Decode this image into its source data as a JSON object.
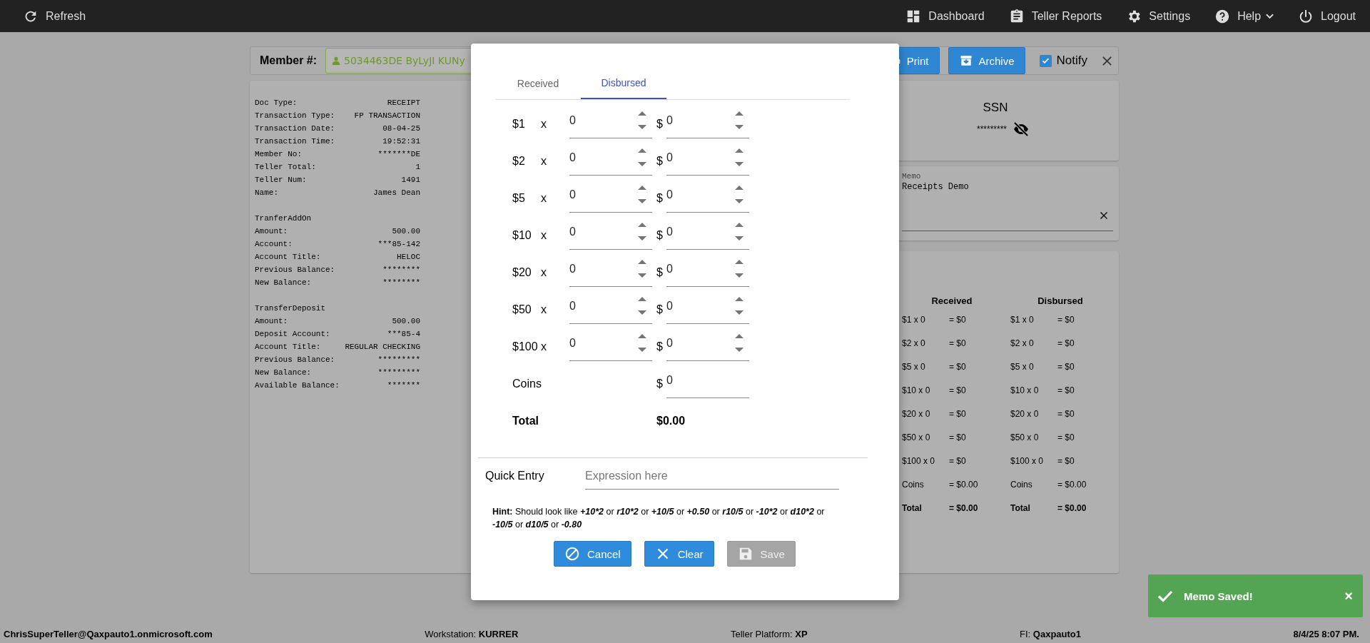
{
  "nav": {
    "left": [
      {
        "kind": "refresh",
        "label": "Refresh"
      }
    ],
    "right": [
      {
        "kind": "dashboard",
        "label": "Dashboard",
        "dropdown": false
      },
      {
        "kind": "reports",
        "label": "Teller Reports",
        "dropdown": false
      },
      {
        "kind": "settings",
        "label": "Settings",
        "dropdown": false
      },
      {
        "kind": "help",
        "label": "Help",
        "dropdown": true
      },
      {
        "kind": "logout",
        "label": "Logout",
        "dropdown": false
      }
    ]
  },
  "member_bar": {
    "label": "Member #:",
    "member": "5034463DE ByLyJI KUNy",
    "buttons": [
      {
        "kind": "print",
        "label": "Print"
      },
      {
        "kind": "archive",
        "label": "Archive"
      }
    ],
    "notify": {
      "label": "Notify",
      "checked": true
    }
  },
  "receipt": {
    "sections": [
      {
        "lines": [
          {
            "label": "Doc Type:",
            "value": "RECEIPT"
          },
          {
            "label": "Transaction Type:",
            "value": "FP TRANSACTION"
          },
          {
            "label": "Transaction Date:",
            "value": "08-04-25"
          },
          {
            "label": "Transaction Time:",
            "value": "19:52:31"
          },
          {
            "label": "Member No:",
            "value": "*******DE"
          },
          {
            "label": "Teller Total:",
            "value": "1"
          },
          {
            "label": "Teller Num:",
            "value": "1491"
          },
          {
            "label": "Name:",
            "value": "James Dean"
          }
        ]
      },
      {
        "heading": "TranferAddOn",
        "lines": [
          {
            "label": "Amount:",
            "value": "500.00"
          },
          {
            "label": "Account:",
            "value": "***85-142"
          },
          {
            "label": "Account Title:",
            "value": "HELOC"
          },
          {
            "label": "Previous Balance:",
            "value": "********"
          },
          {
            "label": "New Balance:",
            "value": "********"
          }
        ]
      },
      {
        "heading": "TransferDeposit",
        "lines": [
          {
            "label": "Amount:",
            "value": "500.00"
          },
          {
            "label": "Deposit Account:",
            "value": "***85-4"
          },
          {
            "label": "Account Title:",
            "value": "REGULAR CHECKING"
          },
          {
            "label": "Previous Balance:",
            "value": "*********"
          },
          {
            "label": "New Balance:",
            "value": "*********"
          },
          {
            "label": "Available Balance:",
            "value": "*******"
          }
        ]
      }
    ]
  },
  "ssn": {
    "label": "SSN",
    "value": "*********",
    "masked": true
  },
  "memo": {
    "label": "Memo",
    "value": "Receipts Demo"
  },
  "summary": {
    "columns": [
      {
        "title": "Received",
        "rows": [
          {
            "kind": "item",
            "label": "$1 x 0",
            "value": "= $0"
          },
          {
            "kind": "item",
            "label": "$2 x 0",
            "value": "= $0"
          },
          {
            "kind": "item",
            "label": "$5 x 0",
            "value": "= $0"
          },
          {
            "kind": "item",
            "label": "$10 x 0",
            "value": "= $0"
          },
          {
            "kind": "item",
            "label": "$20 x 0",
            "value": "= $0"
          },
          {
            "kind": "item",
            "label": "$50 x 0",
            "value": "= $0"
          },
          {
            "kind": "item",
            "label": "$100 x 0",
            "value": "= $0"
          },
          {
            "kind": "item",
            "label": "Coins",
            "value": "= $0.00"
          },
          {
            "kind": "total",
            "label": "Total",
            "value": "= $0.00"
          }
        ]
      },
      {
        "title": "Disbursed",
        "rows": [
          {
            "kind": "item",
            "label": "$1 x 0",
            "value": "= $0"
          },
          {
            "kind": "item",
            "label": "$2 x 0",
            "value": "= $0"
          },
          {
            "kind": "item",
            "label": "$5 x 0",
            "value": "= $0"
          },
          {
            "kind": "item",
            "label": "$10 x 0",
            "value": "= $0"
          },
          {
            "kind": "item",
            "label": "$20 x 0",
            "value": "= $0"
          },
          {
            "kind": "item",
            "label": "$50 x 0",
            "value": "= $0"
          },
          {
            "kind": "item",
            "label": "$100 x 0",
            "value": "= $0"
          },
          {
            "kind": "item",
            "label": "Coins",
            "value": "= $0.00"
          },
          {
            "kind": "total",
            "label": "Total",
            "value": "= $0.00"
          }
        ]
      }
    ]
  },
  "modal": {
    "tabs": [
      {
        "label": "Received",
        "selected": false
      },
      {
        "label": "Disbursed",
        "selected": true
      }
    ],
    "rows": [
      {
        "denomination": "$1",
        "times": "x",
        "count": "0",
        "currency": "$",
        "amount": "0"
      },
      {
        "denomination": "$2",
        "times": "x",
        "count": "0",
        "currency": "$",
        "amount": "0"
      },
      {
        "denomination": "$5",
        "times": "x",
        "count": "0",
        "currency": "$",
        "amount": "0"
      },
      {
        "denomination": "$10",
        "times": "x",
        "count": "0",
        "currency": "$",
        "amount": "0"
      },
      {
        "denomination": "$20",
        "times": "x",
        "count": "0",
        "currency": "$",
        "amount": "0"
      },
      {
        "denomination": "$50",
        "times": "x",
        "count": "0",
        "currency": "$",
        "amount": "0"
      },
      {
        "denomination": "$100",
        "times": "x",
        "count": "0",
        "currency": "$",
        "amount": "0"
      }
    ],
    "coins": {
      "label": "Coins",
      "currency": "$",
      "amount": "0"
    },
    "total": {
      "label": "Total",
      "value": "$0.00"
    },
    "quick_entry": {
      "label": "Quick Entry",
      "placeholder": "Expression here"
    },
    "hint": {
      "parts": [
        {
          "kind": "label",
          "text": "Hint:"
        },
        {
          "kind": "plain",
          "text": "Should look like"
        },
        {
          "kind": "example",
          "text": "+10*2"
        },
        {
          "kind": "plain",
          "text": "or"
        },
        {
          "kind": "example",
          "text": "r10*2"
        },
        {
          "kind": "plain",
          "text": "or"
        },
        {
          "kind": "example",
          "text": "+10/5"
        },
        {
          "kind": "plain",
          "text": "or"
        },
        {
          "kind": "example",
          "text": "+0.50"
        },
        {
          "kind": "plain",
          "text": "or"
        },
        {
          "kind": "example",
          "text": "r10/5"
        },
        {
          "kind": "plain",
          "text": "or"
        },
        {
          "kind": "example",
          "text": "-10*2"
        },
        {
          "kind": "plain",
          "text": "or"
        },
        {
          "kind": "example",
          "text": "d10*2"
        },
        {
          "kind": "plain",
          "text": "or"
        },
        {
          "kind": "example",
          "text": "-10/5"
        },
        {
          "kind": "plain",
          "text": "or"
        },
        {
          "kind": "example",
          "text": "d10/5"
        },
        {
          "kind": "plain",
          "text": "or"
        },
        {
          "kind": "example",
          "text": "-0.80"
        }
      ]
    },
    "buttons": [
      {
        "kind": "cancel",
        "label": "Cancel",
        "disabled": false
      },
      {
        "kind": "clear",
        "label": "Clear",
        "disabled": false
      },
      {
        "kind": "save",
        "label": "Save",
        "disabled": true
      }
    ]
  },
  "toast": {
    "message": "Memo Saved!",
    "close": "×"
  },
  "status_bar": [
    {
      "kind": "strong",
      "text": "ChrisSuperTeller@Qaxpauto1.onmicrosoft.com"
    },
    {
      "kind": "mixed",
      "text": "Workstation: **KURRER**"
    },
    {
      "kind": "mixed",
      "text": "Teller Platform: **XP**"
    },
    {
      "kind": "mixed",
      "text": "FI: **Qaxpauto1**"
    },
    {
      "kind": "strong",
      "text": "8/4/25 8:07 PM."
    }
  ]
}
